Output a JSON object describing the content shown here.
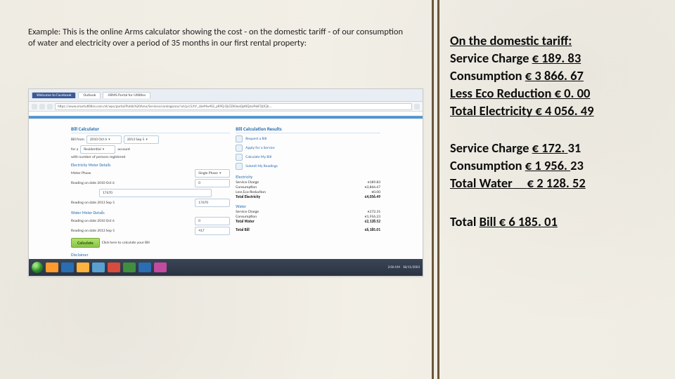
{
  "caption": "Example:  This is the online Arms calculator showing the cost - on the domestic tariff - of our consumption of water and electricity over a period of 35 months in our first rental property:",
  "browser": {
    "tabs": [
      "Welcome to Facebook",
      "Outlook",
      "ARMS Portal for Utilities"
    ],
    "url": "https://www.smartutilities.com.mt/wps/portal/Public%20Area/Services/comingsoon/!ut/p/c5/hY_LbeMw4SS_pR9Q-QLGDXJwaQaKlQmsPskFQUCjh…"
  },
  "form": {
    "heading": "Bill Calculator",
    "billfrom_lbl": "Bill from",
    "date_from": "2010 Oct 6",
    "date_to": "2013 Sep 5",
    "for_lbl": "for a",
    "account_type": "Residential",
    "account_lbl": "account",
    "persons_lbl": "with number of persons registered",
    "elec_details": "Electricity Meter Details",
    "phase_lbl": "Meter Phase",
    "phase_val": "Single Phase",
    "r1_lbl": "Reading on date 2010 Oct 6",
    "r1_val": "0",
    "r1b_val": "17670",
    "r2_lbl": "Reading on date 2013 Sep 5",
    "r2_val": "17670",
    "water_details": "Water Meter Details",
    "w1_lbl": "Reading on date 2010 Oct 6",
    "w1_val": "0",
    "w2_lbl": "Reading on date 2013 Sep 5",
    "w2_val": "417",
    "calculate": "Calculate",
    "hint": "Click here to calculate your Bill",
    "disclaimer": "Disclaimer"
  },
  "links": {
    "request": "Request a Bill",
    "apply": "Apply for a Service",
    "calc": "Calculate My Bill",
    "submit": "Submit My Readings"
  },
  "results": {
    "heading": "Bill Calculation Results",
    "elec_title": "Electricity",
    "svc_lbl": "Service Charge",
    "svc_val": "€189.83",
    "con_lbl": "Consumption",
    "con_val": "€3,866.67",
    "eco_lbl": "Less Eco-Reduction",
    "eco_val": "€0.00",
    "etot_lbl": "Total Electricity",
    "etot_val": "€4,056.49",
    "water_title": "Water",
    "wsvc_lbl": "Service Charge",
    "wsvc_val": "€172.31",
    "wcon_lbl": "Consumption",
    "wcon_val": "€1,956.23",
    "wtot_lbl": "Total Water",
    "wtot_val": "€2,128.52",
    "total_lbl": "Total Bill",
    "total_val": "€6,185.01"
  },
  "tray": {
    "time": "2:06 AM",
    "date": "18/11/2003"
  },
  "taskcolors": [
    "#ff9a2e",
    "#2a6db0",
    "#ffb23e",
    "#5aa0d0",
    "#d94b3c",
    "#3f8f3f",
    "#2a6db0",
    "#c44aa0"
  ],
  "summary": {
    "title": "On the domestic tariff:",
    "l1a": "Service Charge  ",
    "l1b": "€ 189. 83",
    "l2a": "  Consumption  ",
    "l2b": "€ 3 866. 67",
    "l3a": "  Less Eco Reduction  ",
    "l3b": "€ 0. 00",
    "l4a": " Total ",
    "l4b": "Electricity ",
    "l4c": "€ 4 056. 49",
    "w1a": "Service Charge ",
    "w1b": "€ 172. ",
    "w1c": "31",
    "w2a": "Consumption ",
    "w2b": "€ 1 956. ",
    "w2c": "23",
    "w3a": "Total ",
    "w3b": "Water",
    "w3pad": "     ",
    "w3c": "€ 2 128. 52",
    "t_a": "Total ",
    "t_b": "Bill ",
    "t_c": "€ 6 185. 01"
  }
}
